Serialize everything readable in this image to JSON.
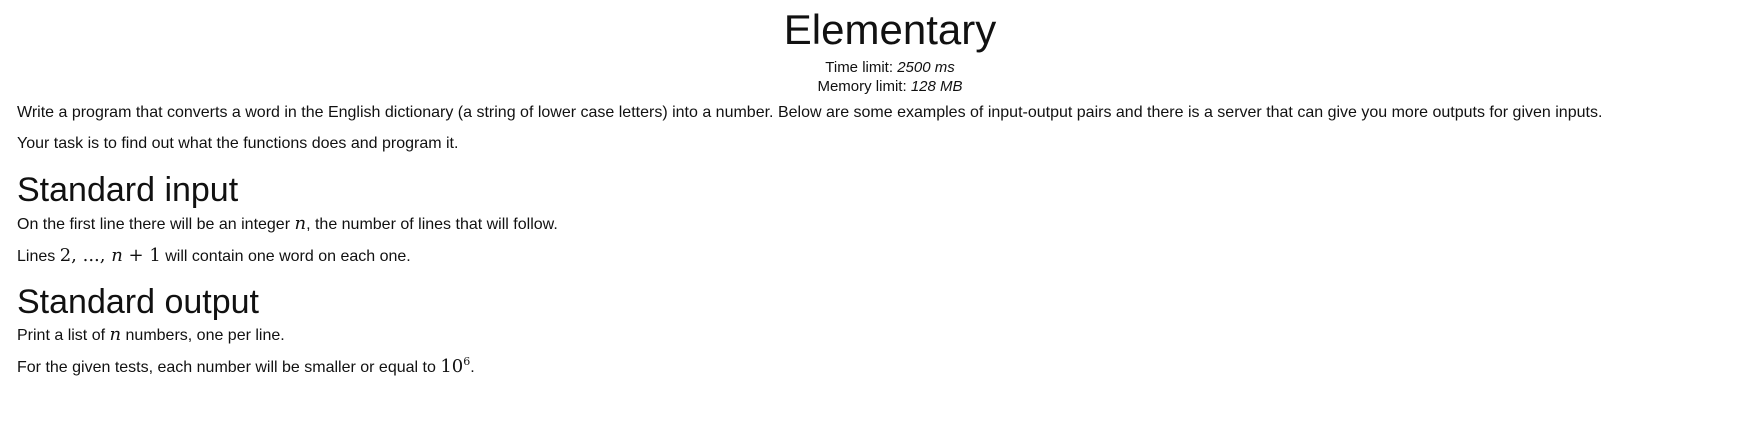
{
  "problem": {
    "title": "Elementary",
    "time_limit_label": "Time limit:",
    "time_limit_value": "2500 ms",
    "memory_limit_label": "Memory limit:",
    "memory_limit_value": "128 MB"
  },
  "statement": {
    "p1": "Write a program that converts a word in the English dictionary (a string of lower case letters) into a number. Below are some examples of input-output pairs and there is a server that can give you more outputs for given inputs.",
    "p2": "Your task is to find out what the functions does and program it."
  },
  "input_section": {
    "heading": "Standard input",
    "line1_pre": "On the first line there will be an integer ",
    "line1_var": "n",
    "line1_post": ", the number of lines that will follow.",
    "line2_pre": "Lines ",
    "line2_math_a": "2, ..., ",
    "line2_math_var": "n",
    "line2_math_b": " + 1",
    "line2_post": " will contain one word on each one."
  },
  "output_section": {
    "heading": "Standard output",
    "line1_pre": "Print a list of ",
    "line1_var": "n",
    "line1_post": " numbers, one per line.",
    "line2_pre": "For the given tests, each number will be smaller or equal to ",
    "line2_base": "10",
    "line2_exp": "6",
    "line2_post": "."
  }
}
